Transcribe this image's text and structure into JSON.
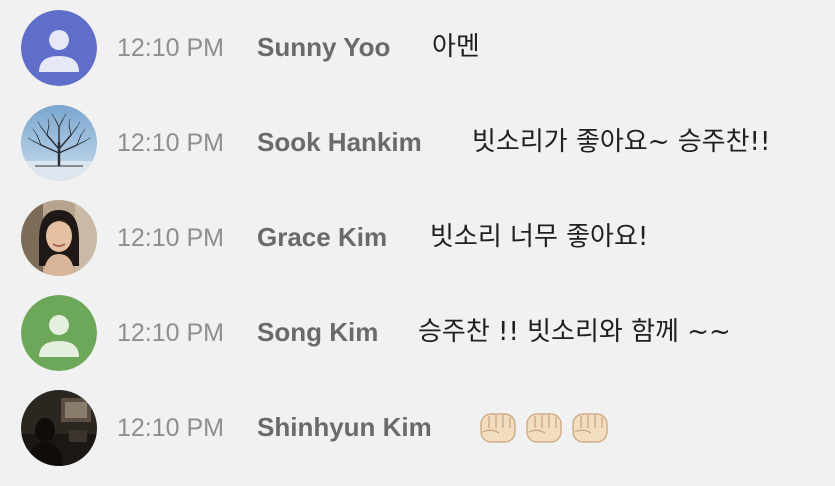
{
  "colors": {
    "background": "#f1f1f1",
    "default_avatar_blue": "#5f6fc9",
    "default_avatar_green": "#6ca75a",
    "time_text": "#8e8e8e",
    "author_text": "#6a6a6a",
    "message_text": "#202020"
  },
  "messages": [
    {
      "avatar": "default-person-blue-icon",
      "time": "12:10 PM",
      "author": "Sunny Yoo",
      "text": "아멘"
    },
    {
      "avatar": "tree-photo",
      "time": "12:10 PM",
      "author": "Sook Hankim",
      "text": "빗소리가 좋아요~ 승주찬!!"
    },
    {
      "avatar": "woman-photo",
      "time": "12:10 PM",
      "author": "Grace Kim",
      "text": "빗소리 너무 좋아요!"
    },
    {
      "avatar": "default-person-green-icon",
      "time": "12:10 PM",
      "author": "Song Kim",
      "text": "승주찬 !! 빗소리와 함께 ~~"
    },
    {
      "avatar": "dark-room-photo",
      "time": "12:10 PM",
      "author": "Shinhyun Kim",
      "text": "",
      "emoji": [
        "fist-emoji",
        "fist-emoji",
        "fist-emoji"
      ]
    }
  ]
}
